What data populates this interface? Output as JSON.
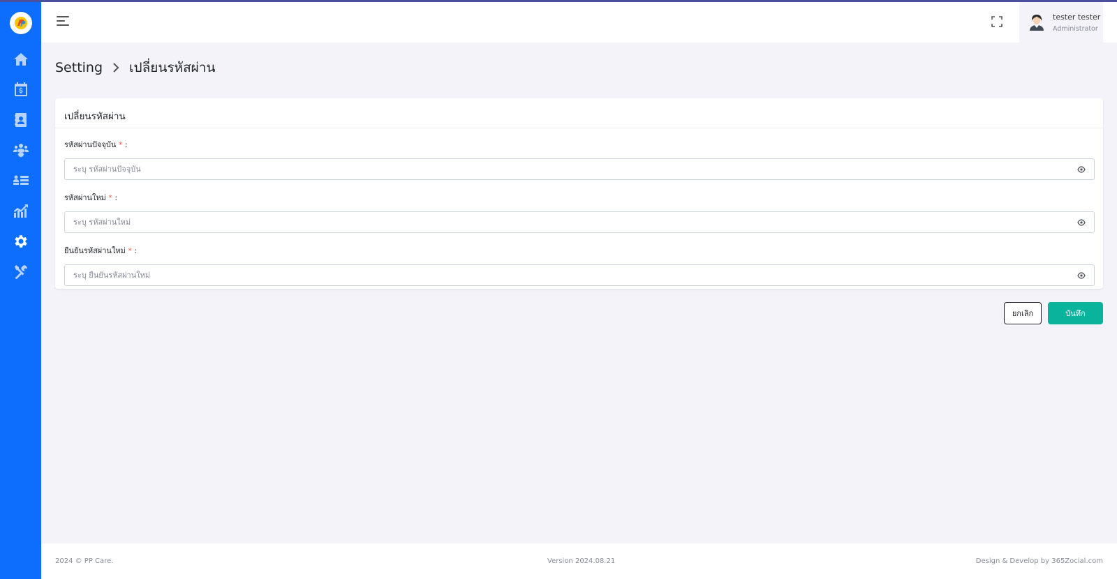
{
  "colors": {
    "sidebar": "#0d6efd",
    "accent": "#0ab39c",
    "required": "#f06548"
  },
  "sidebar": {
    "logo": "pp-care-logo",
    "items": [
      {
        "icon": "home-icon"
      },
      {
        "icon": "calendar-dollar-icon"
      },
      {
        "icon": "contact-book-icon"
      },
      {
        "icon": "users-gear-icon"
      },
      {
        "icon": "user-list-icon"
      },
      {
        "icon": "chart-icon"
      },
      {
        "icon": "gear-icon",
        "active": true
      },
      {
        "icon": "tools-icon"
      }
    ]
  },
  "header": {
    "user_name": "tester tester",
    "user_role": "Administrator"
  },
  "breadcrumb": {
    "parent": "Setting",
    "current": "เปลี่ยนรหัสผ่าน"
  },
  "form": {
    "title": "เปลี่ยนรหัสผ่าน",
    "current_password": {
      "label": "รหัสผ่านปัจจุบัน",
      "required_mark": "*",
      "colon": ":",
      "placeholder": "ระบุ รหัสผ่านปัจจุบัน"
    },
    "new_password": {
      "label": "รหัสผ่านใหม่",
      "required_mark": "*",
      "colon": ":",
      "placeholder": "ระบุ รหัสผ่านใหม่"
    },
    "confirm_password": {
      "label": "ยืนยันรหัสผ่านใหม่",
      "required_mark": "*",
      "colon": ":",
      "placeholder": "ระบุ ยืนยันรหัสผ่านใหม่"
    }
  },
  "actions": {
    "cancel_label": "ยกเลิก",
    "save_label": "บันทึก"
  },
  "footer": {
    "copyright": "2024 © PP Care.",
    "version": "Version 2024.08.21",
    "credit": "Design & Develop by 365Zocial.com"
  }
}
